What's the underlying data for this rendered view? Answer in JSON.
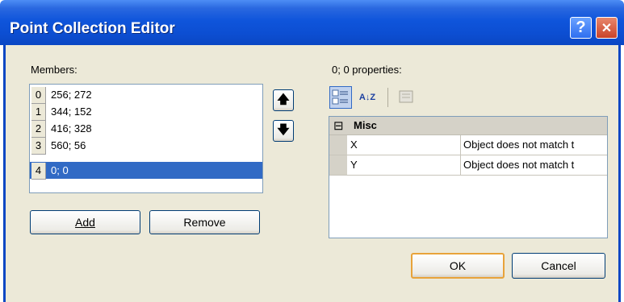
{
  "window": {
    "title": "Point Collection Editor",
    "help_icon": "?",
    "close_icon": "✕"
  },
  "members": {
    "label": "Members:",
    "items": [
      {
        "index": "0",
        "value": "256; 272"
      },
      {
        "index": "1",
        "value": "344; 152"
      },
      {
        "index": "2",
        "value": "416; 328"
      },
      {
        "index": "3",
        "value": "560; 56"
      },
      {
        "index": "4",
        "value": "0; 0"
      }
    ],
    "selected_index": 4,
    "move_up_icon": "🡅",
    "move_down_icon": "🡇"
  },
  "buttons": {
    "add": "Add",
    "remove": "Remove",
    "ok": "OK",
    "cancel": "Cancel"
  },
  "properties": {
    "label": "0; 0 properties:",
    "toolbar": {
      "categorized_icon": "categorized-icon",
      "alphabetical_icon": "A↓Z",
      "pages_icon": "property-pages-icon"
    },
    "category": {
      "toggle": "⊟",
      "name": "Misc"
    },
    "rows": [
      {
        "name": "X",
        "value": "Object does not match t"
      },
      {
        "name": "Y",
        "value": "Object does not match t"
      }
    ]
  },
  "colors": {
    "title_bar": "#0c4ed2",
    "selection": "#316ac5",
    "dialog_bg": "#ece9d8"
  }
}
